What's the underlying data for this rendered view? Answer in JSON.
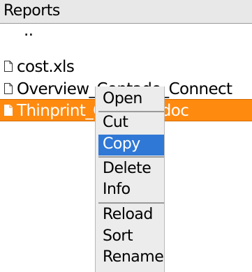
{
  "header": {
    "title": "Reports"
  },
  "files": [
    {
      "name": "..",
      "type": "parent"
    },
    {
      "name": "cost.xls",
      "type": "file"
    },
    {
      "name": "Overview_Contado_Connect",
      "type": "file"
    },
    {
      "name": "Thinprint_Connect.doc",
      "type": "file",
      "selected": true
    }
  ],
  "context_menu": {
    "items": [
      "Open",
      "Cut",
      "Copy",
      "Delete",
      "Info",
      "Reload",
      "Sort",
      "Rename"
    ],
    "highlighted": "Copy"
  },
  "colors": {
    "selection": "#ff8a10",
    "menu_highlight": "#2f78d6",
    "header_bg": "#e8e8e8",
    "menu_bg": "#ececec"
  }
}
